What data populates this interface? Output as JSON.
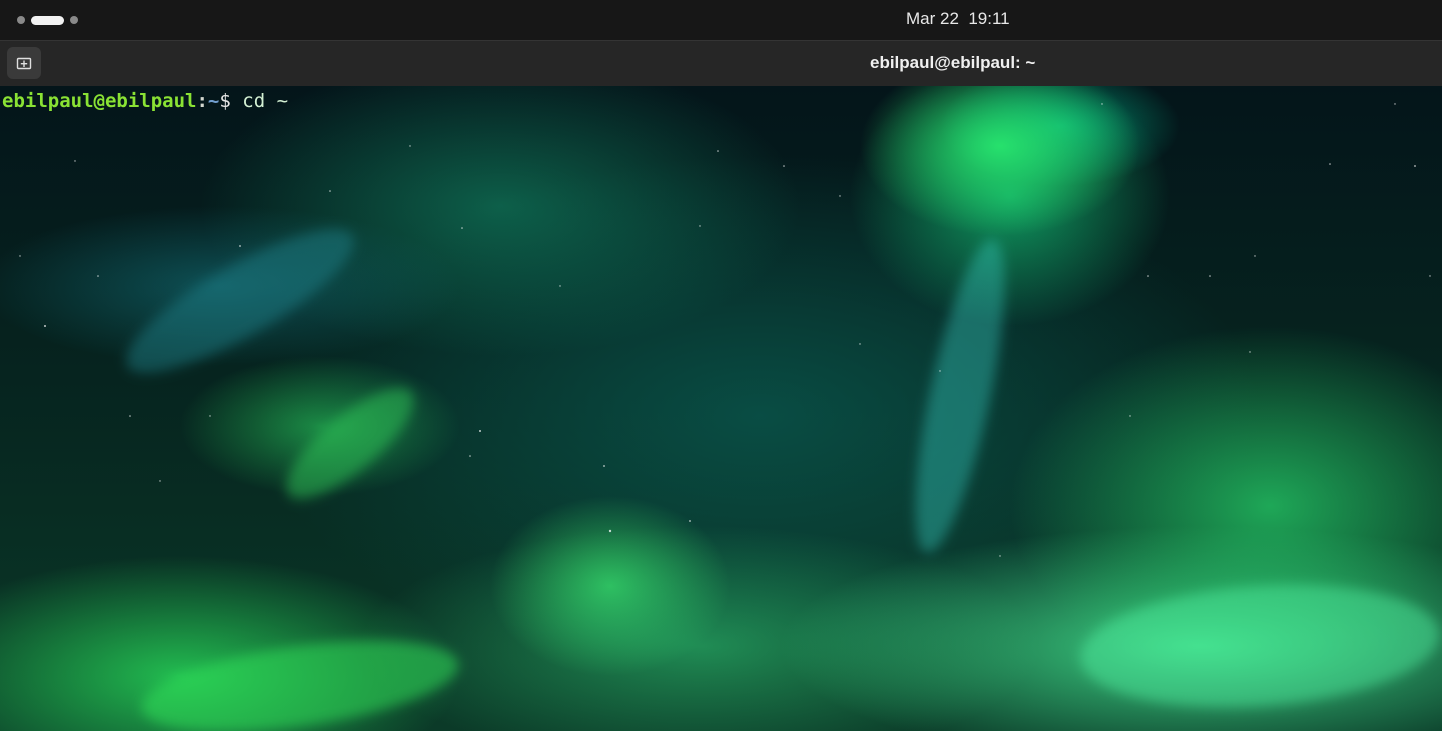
{
  "topbar": {
    "workspace_count": 3,
    "active_workspace": 1,
    "clock": "Mar 22  19:11"
  },
  "terminal": {
    "new_tab_icon": "new-tab-icon",
    "title": "ebilpaul@ebilpaul: ~",
    "prompt": {
      "user_host": "ebilpaul@ebilpaul",
      "colon": ":",
      "path": "~",
      "symbol": "$",
      "command": " cd ~"
    },
    "colors": {
      "user_host": "#8ae234",
      "path": "#729fcf",
      "background_accent": "#2de07a"
    }
  }
}
